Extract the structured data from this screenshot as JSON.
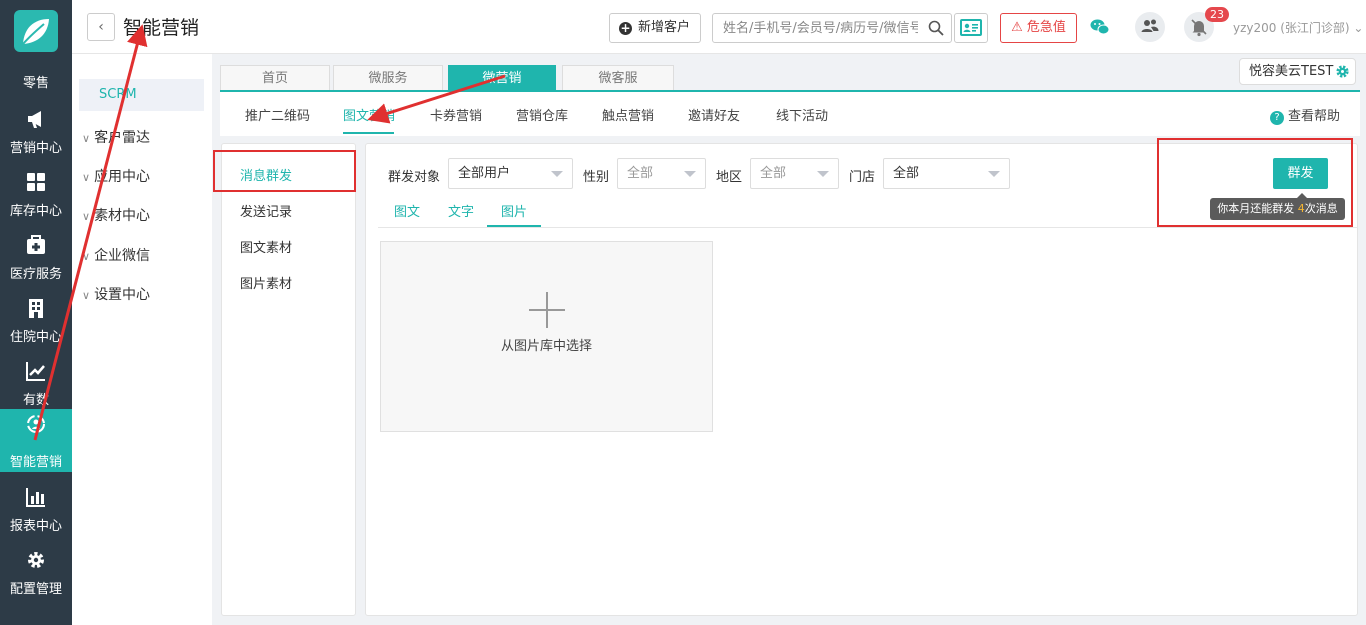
{
  "left_nav": {
    "items": [
      {
        "label": "零售",
        "icon": "leaf-logo-icon"
      },
      {
        "label": "营销中心",
        "icon": "megaphone-icon"
      },
      {
        "label": "库存中心",
        "icon": "grid-icon"
      },
      {
        "label": "医疗服务",
        "icon": "medical-kit-icon"
      },
      {
        "label": "住院中心",
        "icon": "hospital-icon"
      },
      {
        "label": "有数",
        "icon": "line-chart-icon"
      },
      {
        "label": "智能营销",
        "icon": "smart-marketing-icon",
        "active": true
      },
      {
        "label": "报表中心",
        "icon": "bar-chart-icon"
      },
      {
        "label": "配置管理",
        "icon": "gear-icon"
      }
    ]
  },
  "header": {
    "back": "‹",
    "title": "智能营销",
    "new_customer": "新增客户",
    "search_placeholder": "姓名/手机号/会员号/病历号/微信号",
    "danger_label": "危急值",
    "notification_count": "23",
    "user": "yzy200 (张江门诊部)"
  },
  "sidebar": {
    "scrm": "SCRM",
    "items": [
      "客户雷达",
      "应用中心",
      "素材中心",
      "企业微信",
      "设置中心"
    ]
  },
  "tabs": [
    "首页",
    "微服务",
    "微营销",
    "微客服"
  ],
  "store": "悦容美云TEST",
  "subnav": {
    "items": [
      "推广二维码",
      "图文营销",
      "卡券营销",
      "营销仓库",
      "触点营销",
      "邀请好友",
      "线下活动"
    ],
    "help": "查看帮助"
  },
  "message_menu": [
    "消息群发",
    "发送记录",
    "图文素材",
    "图片素材"
  ],
  "filters": {
    "target_label": "群发对象",
    "target_value": "全部用户",
    "gender_label": "性别",
    "gender_value": "全部",
    "region_label": "地区",
    "region_value": "全部",
    "store_label": "门店",
    "store_value": "全部"
  },
  "content_tabs": [
    "图文",
    "文字",
    "图片"
  ],
  "picture_picker": "从图片库中选择",
  "send_button": "群发",
  "tooltip": {
    "prefix": "你本月还能群发 ",
    "count": "4",
    "suffix": "次消息"
  },
  "colors": {
    "accent": "#1fb5ad",
    "nav_bg": "#2d3b47",
    "highlight": "#e03030"
  }
}
